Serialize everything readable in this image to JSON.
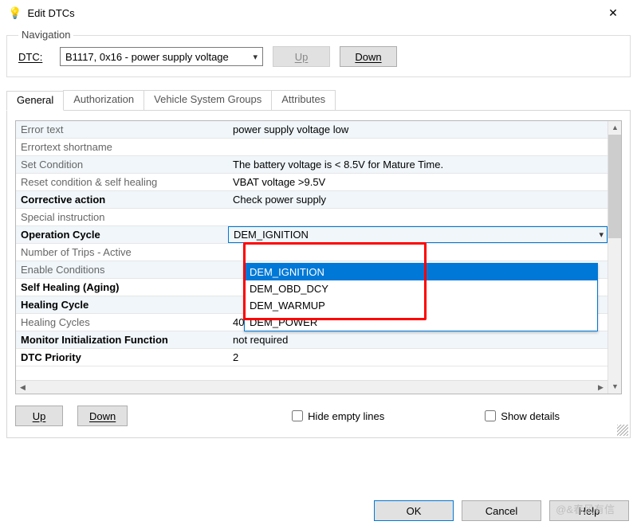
{
  "window": {
    "title": "Edit DTCs",
    "icon": "💡"
  },
  "navigation": {
    "legend": "Navigation",
    "dtc_label": "DTC:",
    "dtc_selected": "B1117, 0x16 - power supply voltage",
    "up_label": "Up",
    "down_label": "Down"
  },
  "tabs": {
    "items": [
      {
        "label": "General"
      },
      {
        "label": "Authorization"
      },
      {
        "label": "Vehicle System Groups"
      },
      {
        "label": "Attributes"
      }
    ]
  },
  "grid": {
    "rows": [
      {
        "label": "Error text",
        "value": "power supply voltage low",
        "alt": true,
        "bold": false
      },
      {
        "label": "Errortext shortname",
        "value": "",
        "alt": false,
        "bold": false
      },
      {
        "label": "Set Condition",
        "value": "The battery voltage is < 8.5V for Mature Time.",
        "alt": true,
        "bold": false
      },
      {
        "label": "Reset condition & self healing",
        "value": "VBAT voltage >9.5V",
        "alt": false,
        "bold": false
      },
      {
        "label": "Corrective action",
        "value": "Check power supply",
        "alt": true,
        "bold": true
      },
      {
        "label": "Special instruction",
        "value": "",
        "alt": false,
        "bold": false
      },
      {
        "label": "Operation Cycle",
        "value": "DEM_IGNITION",
        "alt": true,
        "bold": true
      },
      {
        "label": "Number of Trips - Active",
        "value": "",
        "alt": false,
        "bold": false
      },
      {
        "label": "Enable Conditions",
        "value": "",
        "alt": true,
        "bold": false
      },
      {
        "label": "Self Healing (Aging)",
        "value": "",
        "alt": false,
        "bold": true
      },
      {
        "label": "Healing Cycle",
        "value": "",
        "alt": true,
        "bold": true
      },
      {
        "label": "Healing Cycles",
        "value": "40",
        "alt": false,
        "bold": false
      },
      {
        "label": "Monitor Initialization Function",
        "value": "not required",
        "alt": true,
        "bold": true
      },
      {
        "label": "DTC Priority",
        "value": "2",
        "alt": false,
        "bold": true
      }
    ]
  },
  "operation_cycle": {
    "selected": "DEM_IGNITION",
    "options": [
      "DEM_IGNITION",
      "DEM_OBD_DCY",
      "DEM_WARMUP",
      "DEM_POWER"
    ]
  },
  "panel_footer": {
    "up_label": "Up",
    "down_label": "Down",
    "hide_empty_label": "Hide empty lines",
    "show_details_label": "Show details"
  },
  "dialog": {
    "ok_label": "OK",
    "cancel_label": "Cancel",
    "help_label": "Help",
    "watermark": "@&春风有信"
  }
}
